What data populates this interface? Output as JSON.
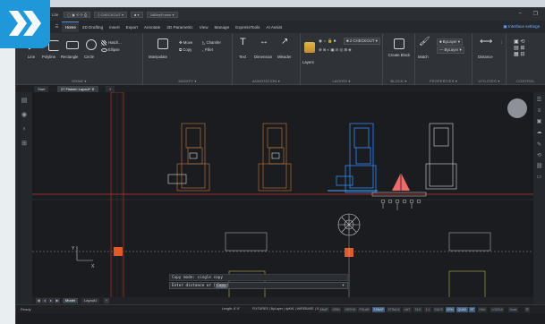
{
  "app": {
    "title": "Lite",
    "layer_select": "2 CHECKOUT",
    "linetype_select": "2dBinsFrame",
    "brand_color": "#1f97d9"
  },
  "menu": {
    "tabs": [
      "Home",
      "2D Drafting",
      "Insert",
      "Export",
      "Annotate",
      "2D Parametric",
      "View",
      "Manage",
      "ExpressTools",
      "AI Assist"
    ],
    "active": "Home",
    "interface_settings": "Interface settings"
  },
  "ribbon": {
    "draw": {
      "title": "DRAW",
      "line": "Line",
      "polyline": "Polyline",
      "rectangle": "Rectangle",
      "circle": "Circle",
      "hatch": "Hatch...",
      "ellipse": "Ellipse"
    },
    "modify": {
      "title": "MODIFY",
      "manipulate": "Manipulate",
      "move": "Move",
      "copy": "Copy",
      "chamfer": "Chamfer",
      "fillet": "Fillet"
    },
    "annotation": {
      "title": "ANNOTATION",
      "text": "Text",
      "dimension": "Dimension",
      "mleader": "Mleader"
    },
    "layers": {
      "title": "LAYERS",
      "layers": "Layers",
      "layer_current": "2 CHECKOUT"
    },
    "block": {
      "title": "BLOCK",
      "create_block": "Create Block"
    },
    "properties": {
      "title": "PROPERTIES",
      "match": "Match",
      "color": "ByLayer",
      "linetype": "ByLayer"
    },
    "utilities": {
      "title": "UTILITIES",
      "distance": "Distance"
    },
    "control": {
      "title": "CONTROL"
    }
  },
  "doc_tabs": [
    "Start",
    "27 Fisbein Layout*"
  ],
  "command": {
    "history": "Copy mode: single copy",
    "prompt_prefix": "Enter distance or",
    "option": "Copy"
  },
  "layout_tabs": [
    "Model",
    "Layout1"
  ],
  "status": {
    "ready": "Ready",
    "coords": "Length: 8'-9\"",
    "info": "FIXTURES | ByLayer | dyKit1 | WIREBASE | Drafting",
    "toggles": [
      "SNAP",
      "GRID",
      "ORTHO",
      "POLAR",
      "ESNAP",
      "STRACK",
      "LWT",
      "TILE",
      "1:1",
      "DUCS",
      "DYN",
      "QUAD",
      "RT",
      "HKA",
      "LOCKUI",
      "None"
    ],
    "on": [
      "ESNAP",
      "DYN",
      "QUAD",
      "RT"
    ]
  },
  "colors": {
    "drawing_orange": "#c97a3a",
    "selected_blue": "#2f7fe0",
    "marker_red": "#e05a3a",
    "axis_red": "#c0392b"
  }
}
